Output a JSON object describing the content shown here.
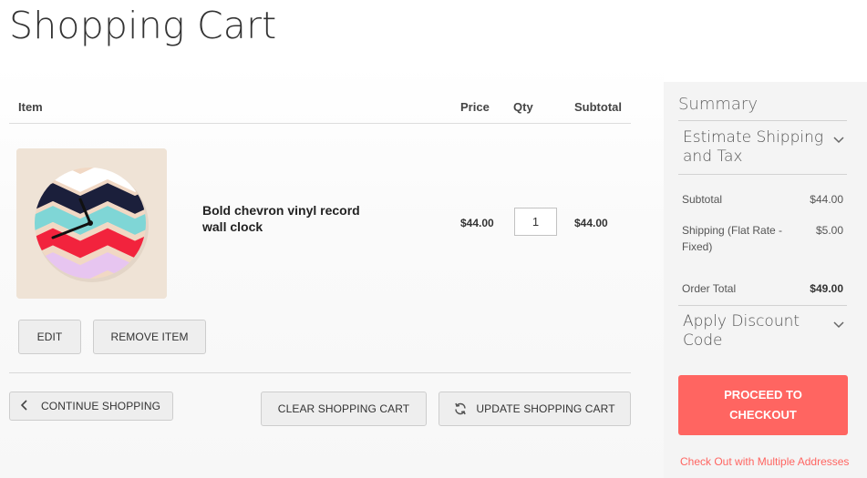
{
  "page": {
    "title": "Shopping Cart"
  },
  "table": {
    "headers": {
      "item": "Item",
      "price": "Price",
      "qty": "Qty",
      "subtotal": "Subtotal"
    }
  },
  "cart_item": {
    "name": "Bold chevron vinyl record wall clock",
    "price": "$44.00",
    "qty": "1",
    "subtotal": "$44.00",
    "image_icon": "chevron-clock-image"
  },
  "actions": {
    "edit": "Edit",
    "remove": "Remove item",
    "continue": "Continue Shopping",
    "clear": "Clear Shopping Cart",
    "update": "Update Shopping Cart"
  },
  "summary": {
    "title": "Summary",
    "estimate": "Estimate Shipping and Tax",
    "subtotal_label": "Subtotal",
    "subtotal_value": "$44.00",
    "shipping_label": "Shipping (Flat Rate - Fixed)",
    "shipping_value": "$5.00",
    "order_total_label": "Order Total",
    "order_total_value": "$49.00",
    "discount": "Apply Discount Code",
    "checkout": "Proceed to Checkout",
    "multi_address": "Check Out with Multiple Addresses"
  },
  "colors": {
    "accent": "#ff6561",
    "summary_bg": "#f4f4f4",
    "button_bg": "#eeeeee"
  }
}
